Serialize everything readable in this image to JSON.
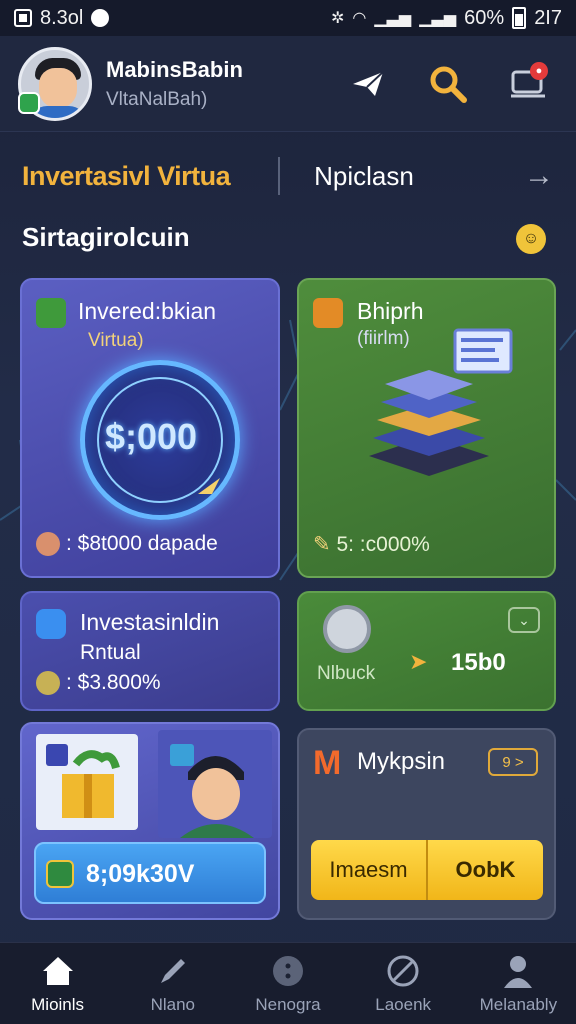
{
  "status_bar": {
    "time": "8.3ol",
    "battery": "60%",
    "extra": "2I7"
  },
  "header": {
    "user_name": "MabinsBabin",
    "user_sub": "VltaNalBah)"
  },
  "tabs": {
    "active": "Invertasivl Virtua",
    "other": "Npiclasn"
  },
  "section": {
    "title": "Sirtagirolcuin"
  },
  "cards": {
    "card1": {
      "title": "Invered:bkian",
      "sub": "Virtua)",
      "value": "$;000",
      "foot": ": $8t000 dapade"
    },
    "card2": {
      "title": "Bhiprh",
      "sub": "(fiirlm)",
      "foot": "5: :c000%"
    },
    "card3": {
      "title": "Investasinldin",
      "sub": "Rntual",
      "foot": ": $3.800%"
    },
    "card4": {
      "label": "Nlbuck",
      "value": "15b0"
    },
    "card5": {
      "bar_text": "8;09k30V"
    },
    "card6": {
      "title": "Mykpsin",
      "pill": "9 >",
      "btn_left": "Imaesm",
      "btn_right": "OobK"
    }
  },
  "bottom_nav": [
    {
      "label": "Mioinls",
      "icon": "home-icon"
    },
    {
      "label": "Nlano",
      "icon": "pencil-icon"
    },
    {
      "label": "Nenogra",
      "icon": "dots-icon"
    },
    {
      "label": "Laoenk",
      "icon": "compass-icon"
    },
    {
      "label": "Melanably",
      "icon": "profile-icon"
    }
  ],
  "colors": {
    "accent": "#f2b33d",
    "card_blue": "#4f52b4",
    "card_green": "#4a8b3a",
    "button_yellow": "#f7c42c"
  }
}
